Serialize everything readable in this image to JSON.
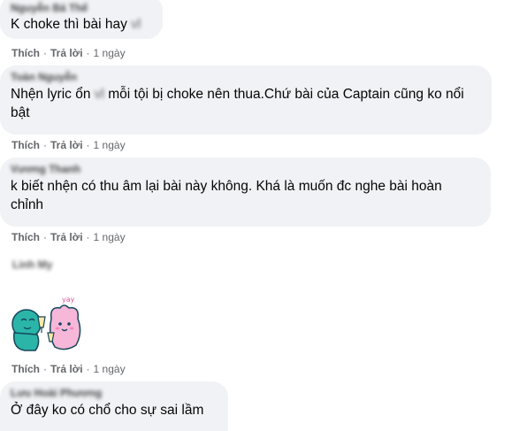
{
  "comments": [
    {
      "author": "Nguyễn Bá Thế",
      "text_before": "K choke thì bài hay ",
      "blurred": "vl",
      "text_after": "",
      "actions": {
        "like": "Thích",
        "reply": "Trả lời",
        "time": "1 ngày"
      }
    },
    {
      "author": "Toàn Nguyễn",
      "text_before": "Nhện lyric ổn ",
      "blurred": "vl",
      "text_after": " mỗi tội bị choke nên thua.Chứ bài của Captain cũng ko nổi bật",
      "actions": {
        "like": "Thích",
        "reply": "Trả lời",
        "time": "1 ngày"
      }
    },
    {
      "author": "Vương Thanh",
      "text": "k biết nhện có thu âm lại bài này không. Khá là muốn đc nghe bài hoàn chỉnh",
      "actions": {
        "like": "Thích",
        "reply": "Trả lời",
        "time": "1 ngày"
      }
    },
    {
      "author": "Linh My",
      "sticker": "yay-cheers-sticker",
      "sticker_text": "yay",
      "actions": {
        "like": "Thích",
        "reply": "Trả lời",
        "time": "1 ngày"
      }
    },
    {
      "author": "Lưu Hoài Phương",
      "text": "Ở đây ko có chổ cho sự sai lầm"
    }
  ],
  "separator": "·",
  "colors": {
    "bubble": "#f0f2f5",
    "text": "#050505",
    "meta": "#65676b",
    "sticker_green": "#2bb5a8",
    "sticker_pink": "#f6b7d9"
  }
}
